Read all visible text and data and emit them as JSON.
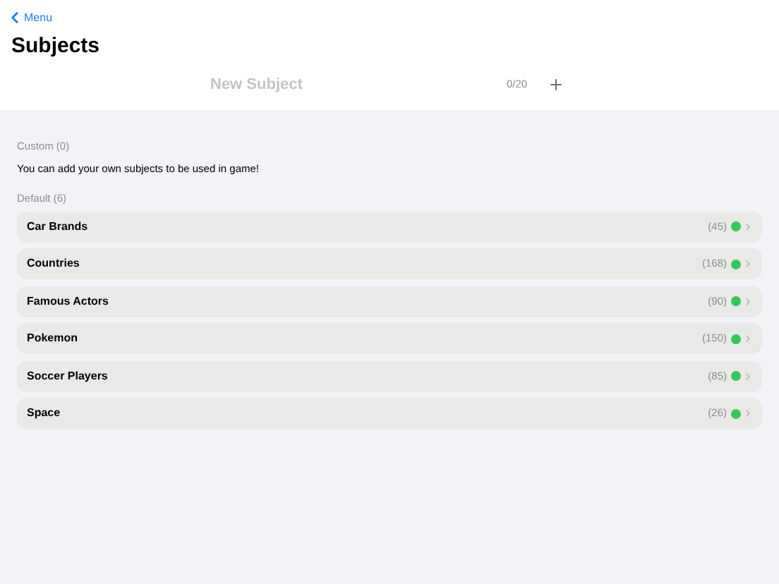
{
  "nav": {
    "back_label": "Menu"
  },
  "title": "Subjects",
  "new_subject": {
    "placeholder": "New Subject",
    "counter": "0/20"
  },
  "custom": {
    "heading": "Custom (0)",
    "message": "You can add your own subjects to be used in game!"
  },
  "default": {
    "heading": "Default (6)",
    "items": [
      {
        "name": "Car Brands",
        "count": "(45)",
        "enabled": true
      },
      {
        "name": "Countries",
        "count": "(168)",
        "enabled": true
      },
      {
        "name": "Famous Actors",
        "count": "(90)",
        "enabled": true
      },
      {
        "name": "Pokemon",
        "count": "(150)",
        "enabled": true
      },
      {
        "name": "Soccer Players",
        "count": "(85)",
        "enabled": true
      },
      {
        "name": "Space",
        "count": "(26)",
        "enabled": true
      }
    ]
  }
}
